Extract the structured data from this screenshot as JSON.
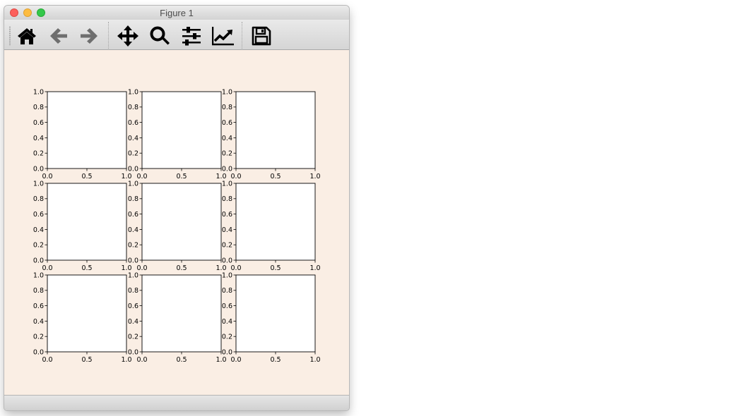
{
  "window": {
    "title": "Figure 1"
  },
  "toolbar": {
    "buttons": [
      {
        "name": "home",
        "icon": "home-icon",
        "color": "#000000"
      },
      {
        "name": "back",
        "icon": "arrow-left-icon",
        "color": "#6e6e6e"
      },
      {
        "name": "forward",
        "icon": "arrow-right-icon",
        "color": "#6e6e6e"
      },
      {
        "name": "pan",
        "icon": "move-arrows-icon",
        "color": "#000000"
      },
      {
        "name": "zoom",
        "icon": "magnifier-icon",
        "color": "#000000"
      },
      {
        "name": "configure-subplots",
        "icon": "sliders-icon",
        "color": "#000000"
      },
      {
        "name": "edit-axis",
        "icon": "line-chart-icon",
        "color": "#000000"
      },
      {
        "name": "save",
        "icon": "floppy-disk-icon",
        "color": "#000000"
      }
    ]
  },
  "figure": {
    "facecolor": "#faeee4",
    "axes_facecolor": "#ffffff"
  },
  "chart_data": {
    "type": "scatter",
    "layout": "3x3 grid of empty axes",
    "rows": 3,
    "cols": 3,
    "axes_count": 9,
    "series": [],
    "xlim": [
      0.0,
      1.0
    ],
    "ylim": [
      0.0,
      1.0
    ],
    "xticks": [
      "0.0",
      "0.5",
      "1.0"
    ],
    "yticks": [
      "0.0",
      "0.2",
      "0.4",
      "0.6",
      "0.8",
      "1.0"
    ],
    "grid": false
  }
}
